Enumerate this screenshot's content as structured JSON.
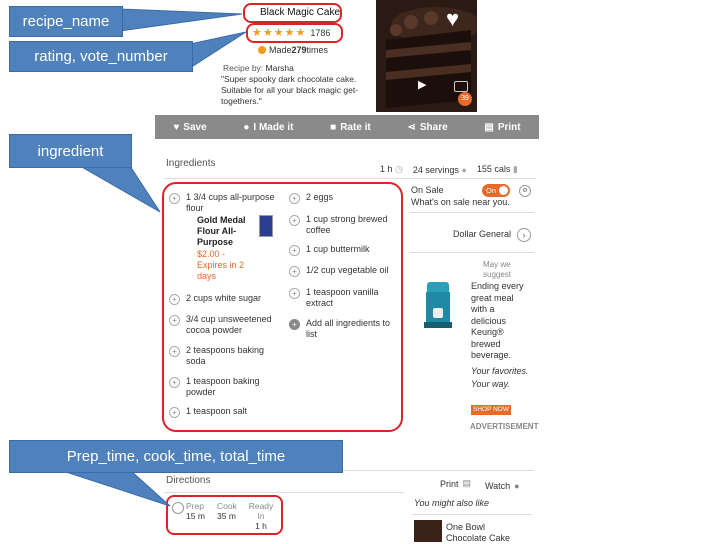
{
  "callouts": {
    "recipe_name": "recipe_name",
    "rating_votes": "rating, vote_number",
    "ingredient": "ingredient",
    "times": "Prep_time, cook_time, total_time"
  },
  "recipe": {
    "name": "Black Magic Cake",
    "rating": 5,
    "votes": "1786",
    "made_prefix": "Made ",
    "made_count": "279",
    "made_suffix": " times",
    "by_label": "Recipe by: ",
    "author": "Marsha",
    "description": "\"Super spooky dark chocolate cake. Suitable for all your black magic get-togethers.\"",
    "photo_count": "39"
  },
  "toolbar": {
    "save": "Save",
    "made_it": "I Made it",
    "rate_it": "Rate it",
    "share": "Share",
    "print": "Print"
  },
  "ingredients_section": {
    "title": "Ingredients",
    "time": "1 h",
    "servings": "24 servings",
    "cals": "155 cals"
  },
  "ingredients": {
    "left": [
      "1 3/4 cups all-purpose flour",
      "2 cups white sugar",
      "3/4 cup unsweetened cocoa powder",
      "2 teaspoons baking soda",
      "1 teaspoon baking powder",
      "1 teaspoon salt"
    ],
    "right": [
      "2 eggs",
      "1 cup strong brewed coffee",
      "1 cup buttermilk",
      "1/2 cup vegetable oil",
      "1 teaspoon vanilla extract",
      "Add all ingredients to list"
    ],
    "product_name": "Gold Medal Flour All-Purpose",
    "product_price": "$2.00 - Expires in 2 days"
  },
  "sale": {
    "label": "On Sale",
    "toggle": "On",
    "subtitle": "What's on sale near you.",
    "store": "Dollar General"
  },
  "ad": {
    "suggest": "May we suggest",
    "body": "Ending every great meal with a delicious Keurig® brewed beverage.",
    "italic1": "Your favorites.",
    "italic2": "Your way.",
    "shop": "SHOP NOW",
    "advert": "ADVERTISEMENT"
  },
  "directions": {
    "title": "Directions",
    "print": "Print",
    "watch": "Watch",
    "prep_label": "Prep",
    "prep_value": "15 m",
    "cook_label": "Cook",
    "cook_value": "35 m",
    "ready_label": "Ready In",
    "ready_value": "1 h",
    "also_like": "You might also like",
    "related": "One Bowl Chocolate Cake"
  },
  "colors": {
    "callout": "#4f81bd",
    "highlight": "#d9252a",
    "star": "#f39a1f",
    "toolbar": "#8a8a8a",
    "accent": "#e8692a"
  }
}
